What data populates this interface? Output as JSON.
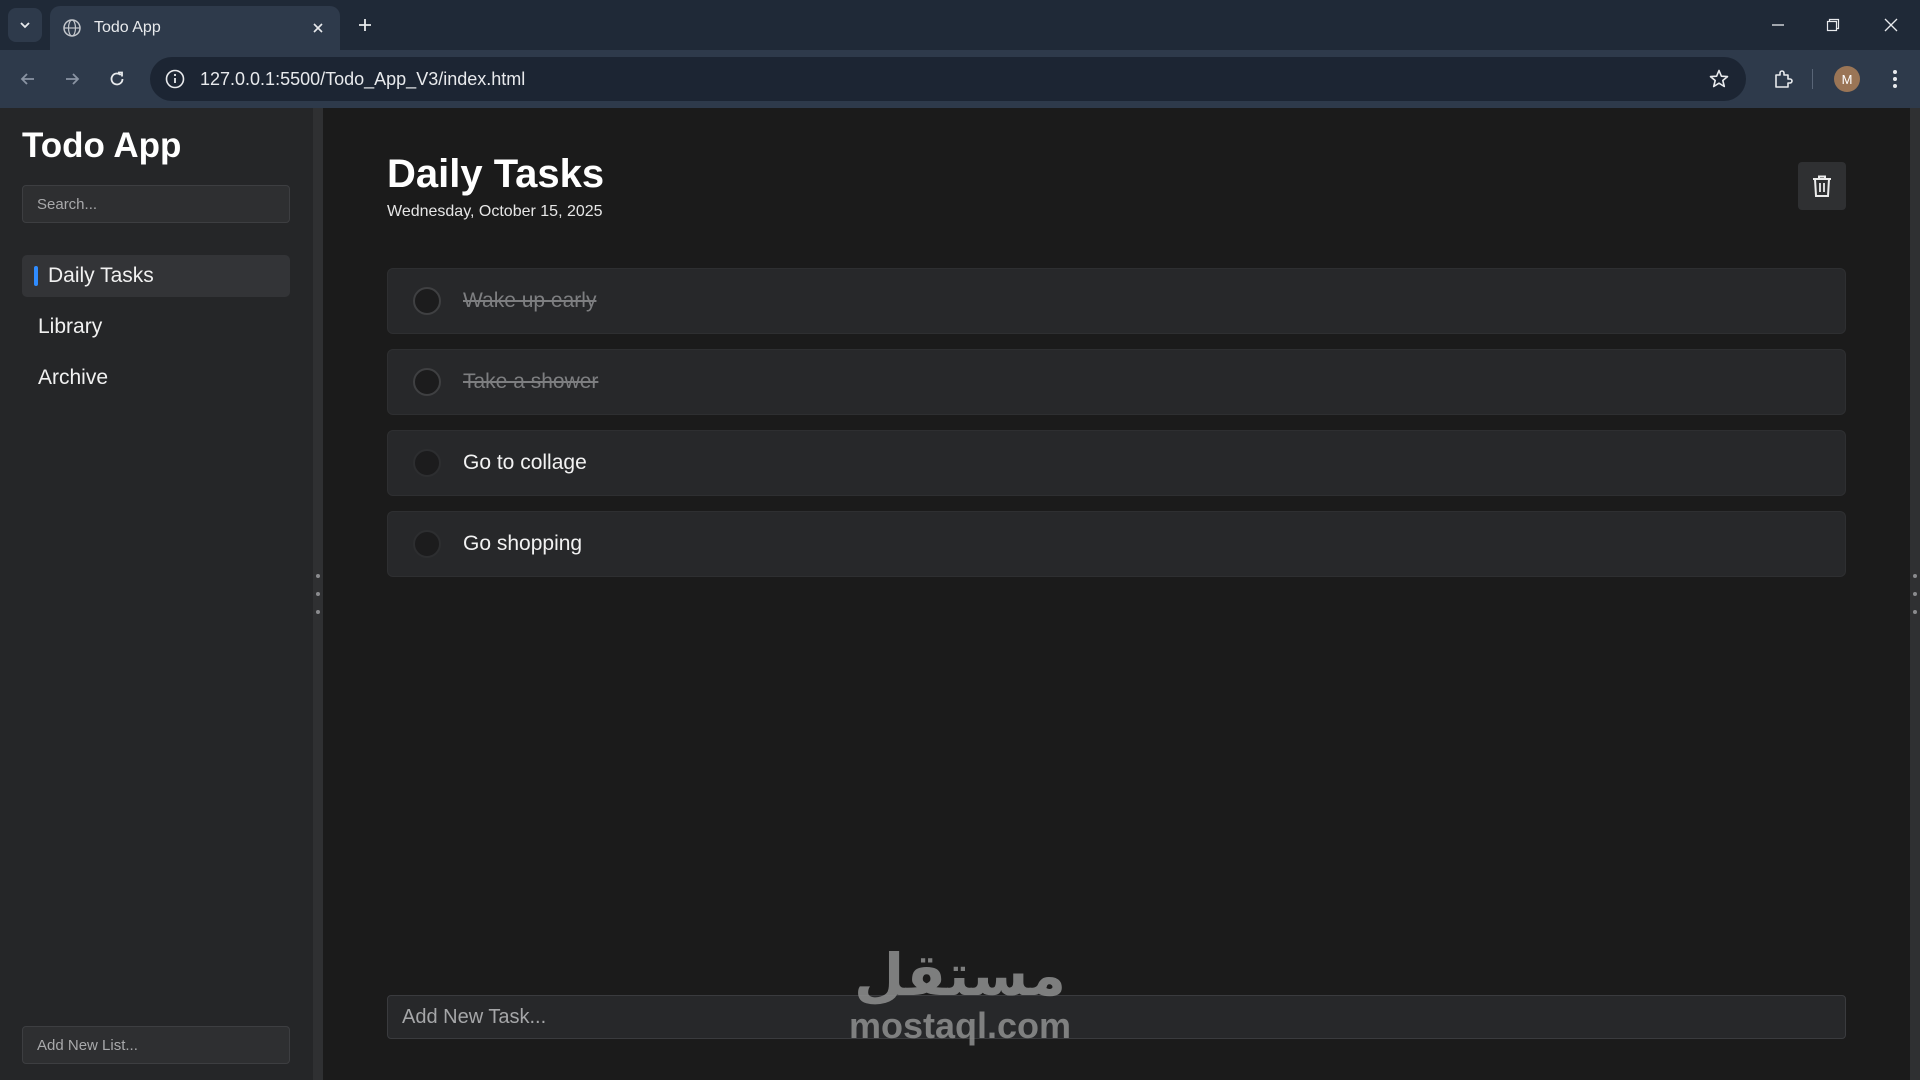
{
  "browser": {
    "tab_title": "Todo App",
    "url": "127.0.0.1:5500/Todo_App_V3/index.html",
    "profile_initial": "M"
  },
  "sidebar": {
    "app_title": "Todo App",
    "search_placeholder": "Search...",
    "items": [
      {
        "label": "Daily Tasks",
        "active": true
      },
      {
        "label": "Library",
        "active": false
      },
      {
        "label": "Archive",
        "active": false
      }
    ],
    "add_list_placeholder": "Add New List..."
  },
  "main": {
    "title": "Daily Tasks",
    "date": "Wednesday, October 15, 2025",
    "tasks": [
      {
        "label": "Wake up early",
        "done": true
      },
      {
        "label": "Take a shower",
        "done": true
      },
      {
        "label": "Go to collage",
        "done": false
      },
      {
        "label": "Go shopping",
        "done": false
      }
    ],
    "add_task_placeholder": "Add New Task..."
  },
  "watermark": {
    "arabic": "مستقل",
    "latin": "mostaql.com"
  },
  "colors": {
    "accent": "#2f8cff",
    "sidebar_bg": "#252628",
    "main_bg": "#1b1b1b",
    "task_bg": "#27282a"
  }
}
